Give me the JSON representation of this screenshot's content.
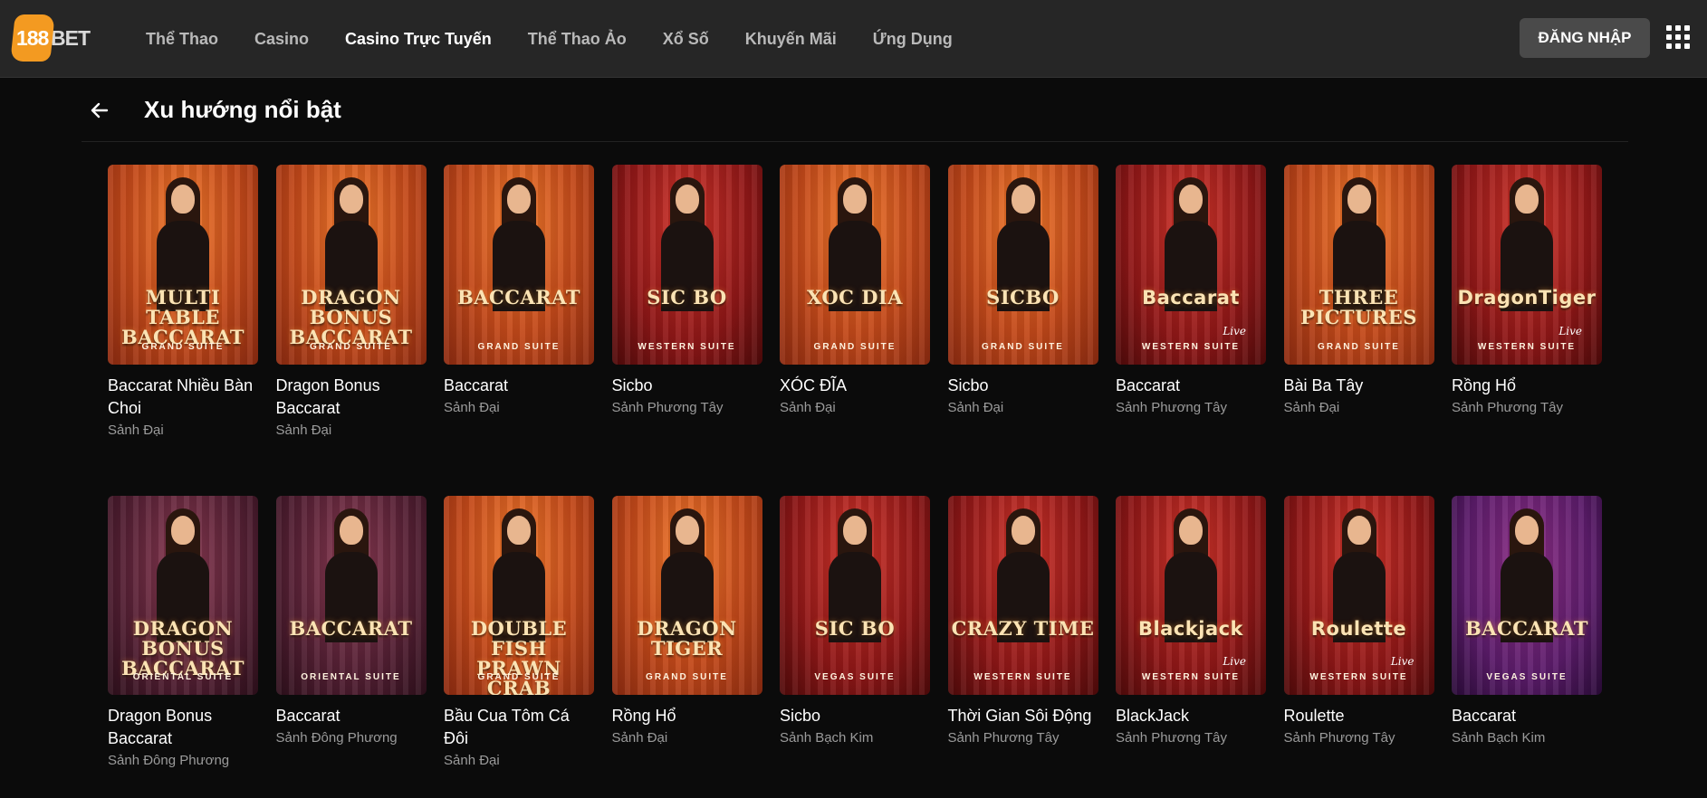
{
  "header": {
    "logo_badge": "188",
    "logo_word": "BET",
    "nav": [
      "Thể Thao",
      "Casino",
      "Casino Trực Tuyến",
      "Thể Thao Ảo",
      "Xổ Số",
      "Khuyến Mãi",
      "Ứng Dụng"
    ],
    "active_nav": "Casino Trực Tuyến",
    "login_label": "ĐĂNG NHẬP"
  },
  "page": {
    "title": "Xu hướng nổi bật"
  },
  "row1": [
    {
      "name": "Baccarat Nhiều Bàn Choi",
      "sub": "Sảnh Đại",
      "art": "MULTI TABLE BACCARAT",
      "suite": "GRAND SUITE",
      "bg": "orange"
    },
    {
      "name": "Dragon Bonus Baccarat",
      "sub": "Sảnh Đại",
      "art": "DRAGON BONUS BACCARAT",
      "suite": "GRAND SUITE",
      "bg": "orange"
    },
    {
      "name": "Baccarat",
      "sub": "Sảnh Đại",
      "art": "BACCARAT",
      "suite": "GRAND SUITE",
      "bg": "orange"
    },
    {
      "name": "Sicbo",
      "sub": "Sảnh Phương Tây",
      "art": "SIC BO",
      "suite": "WESTERN SUITE",
      "bg": "red"
    },
    {
      "name": "XÓC ĐĨA",
      "sub": "Sảnh Đại",
      "art": "XOC DIA",
      "suite": "GRAND SUITE",
      "bg": "orange"
    },
    {
      "name": "Sicbo",
      "sub": "Sảnh Đại",
      "art": "SICBO",
      "suite": "GRAND SUITE",
      "bg": "orange"
    },
    {
      "name": "Baccarat",
      "sub": "Sảnh Phương Tây",
      "art": "Baccarat",
      "live": "Live",
      "suite": "WESTERN SUITE",
      "bg": "red"
    },
    {
      "name": "Bài Ba Tây",
      "sub": "Sảnh Đại",
      "art": "THREE PICTURES",
      "suite": "GRAND SUITE",
      "bg": "orange"
    },
    {
      "name": "Rồng Hổ",
      "sub": "Sảnh Phương Tây",
      "art": "DragonTiger",
      "live": "Live",
      "suite": "WESTERN SUITE",
      "bg": "red"
    }
  ],
  "row2": [
    {
      "name": "Dragon Bonus Baccarat",
      "sub": "Sảnh Đông Phương",
      "art": "DRAGON BONUS BACCARAT",
      "suite": "ORIENTAL SUITE",
      "bg": "plum"
    },
    {
      "name": "Baccarat",
      "sub": "Sảnh Đông Phương",
      "art": "BACCARAT",
      "suite": "ORIENTAL SUITE",
      "bg": "plum"
    },
    {
      "name": "Bầu Cua Tôm Cá Đôi",
      "sub": "Sảnh Đại",
      "art": "DOUBLE FISH PRAWN CRAB",
      "suite": "GRAND SUITE",
      "bg": "orange"
    },
    {
      "name": "Rồng Hổ",
      "sub": "Sảnh Đại",
      "art": "DRAGON TIGER",
      "suite": "GRAND SUITE",
      "bg": "orange"
    },
    {
      "name": "Sicbo",
      "sub": "Sảnh Bạch Kim",
      "art": "SIC BO",
      "suite": "VEGAS SUITE",
      "bg": "red"
    },
    {
      "name": "Thời Gian Sôi Động",
      "sub": "Sảnh Phương Tây",
      "art": "CRAZY TIME",
      "suite": "WESTERN SUITE",
      "bg": "red"
    },
    {
      "name": "BlackJack",
      "sub": "Sảnh Phương Tây",
      "art": "Blackjack",
      "live": "Live",
      "suite": "WESTERN SUITE",
      "bg": "red"
    },
    {
      "name": "Roulette",
      "sub": "Sảnh Phương Tây",
      "art": "Roulette",
      "live": "Live",
      "suite": "WESTERN SUITE",
      "bg": "red"
    },
    {
      "name": "Baccarat",
      "sub": "Sảnh Bạch Kim",
      "art": "BACCARAT",
      "suite": "VEGAS SUITE",
      "bg": "purple"
    }
  ]
}
